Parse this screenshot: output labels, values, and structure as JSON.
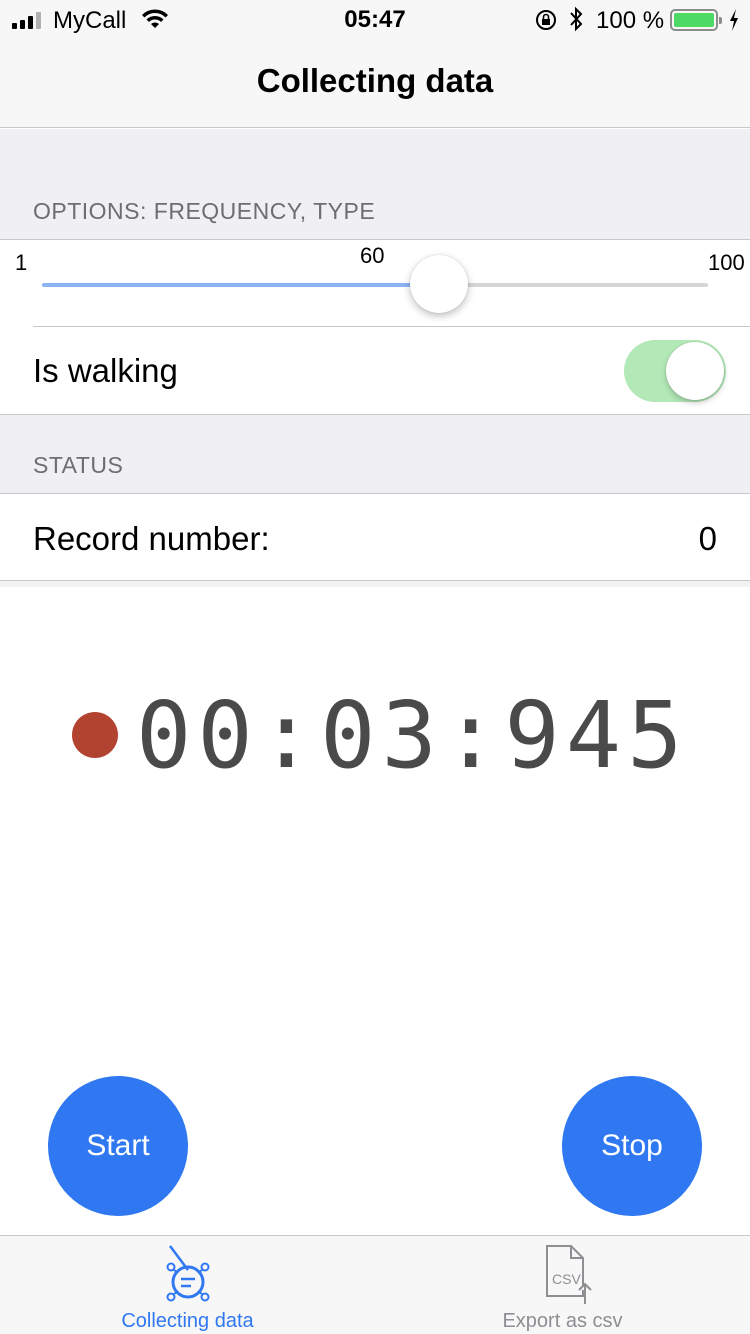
{
  "status_bar": {
    "carrier": "MyCall",
    "time": "05:47",
    "battery_percent": "100 %",
    "icons": [
      "signal-icon",
      "wifi-icon",
      "rotation-lock-icon",
      "bluetooth-icon",
      "battery-icon",
      "charging-icon"
    ]
  },
  "nav": {
    "title": "Collecting data"
  },
  "options_section": {
    "header": "OPTIONS: FREQUENCY, TYPE",
    "slider": {
      "min_label": "1",
      "max_label": "100",
      "value_label": "60",
      "min": 1,
      "max": 100,
      "value": 60
    },
    "walking_toggle": {
      "label": "Is walking",
      "on": true
    }
  },
  "status_section": {
    "header": "STATUS",
    "record": {
      "label": "Record number:",
      "value": "0"
    }
  },
  "timer": {
    "display": "00:03:945",
    "recording": true
  },
  "buttons": {
    "start": "Start",
    "stop": "Stop"
  },
  "tabs": [
    {
      "label": "Collecting data",
      "icon": "collecting-data-icon",
      "active": true
    },
    {
      "label": "Export as csv",
      "icon": "csv-export-icon",
      "active": false
    }
  ],
  "colors": {
    "accent": "#2f78f2",
    "slider_fill": "#8bb4f3",
    "toggle_on": "#b3e8b7",
    "record_dot": "#b34331",
    "timer_text": "#4a4a4a",
    "inactive_tab": "#8e8e93"
  }
}
